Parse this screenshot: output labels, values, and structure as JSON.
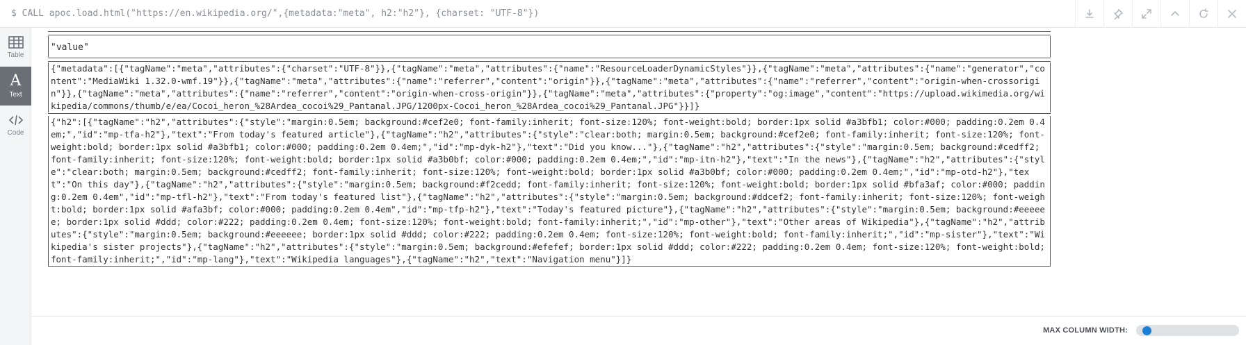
{
  "command": {
    "text": "$ CALL apoc.load.html(\"https://en.wikipedia.org/\",{metadata:\"meta\", h2:\"h2\"}, {charset: \"UTF-8\"})"
  },
  "toolbar": {
    "icons": [
      "download-icon",
      "pin-icon",
      "expand-icon",
      "collapse-up-icon",
      "rerun-icon",
      "close-icon"
    ]
  },
  "sidebar": {
    "items": [
      {
        "label": "Table",
        "icon": "table-icon"
      },
      {
        "label": "Text",
        "icon": "text-icon",
        "active": true
      },
      {
        "label": "Code",
        "icon": "code-icon"
      }
    ]
  },
  "result": {
    "header": "\"value\"",
    "rows": [
      "{\"metadata\":[{\"tagName\":\"meta\",\"attributes\":{\"charset\":\"UTF-8\"}},{\"tagName\":\"meta\",\"attributes\":{\"name\":\"ResourceLoaderDynamicStyles\"}},{\"tagName\":\"meta\",\"attributes\":{\"name\":\"generator\",\"content\":\"MediaWiki 1.32.0-wmf.19\"}},{\"tagName\":\"meta\",\"attributes\":{\"name\":\"referrer\",\"content\":\"origin\"}},{\"tagName\":\"meta\",\"attributes\":{\"name\":\"referrer\",\"content\":\"origin-when-crossorigin\"}},{\"tagName\":\"meta\",\"attributes\":{\"name\":\"referrer\",\"content\":\"origin-when-cross-origin\"}},{\"tagName\":\"meta\",\"attributes\":{\"property\":\"og:image\",\"content\":\"https://upload.wikimedia.org/wikipedia/commons/thumb/e/ea/Cocoi_heron_%28Ardea_cocoi%29_Pantanal.JPG/1200px-Cocoi_heron_%28Ardea_cocoi%29_Pantanal.JPG\"}}]}",
      "{\"h2\":[{\"tagName\":\"h2\",\"attributes\":{\"style\":\"margin:0.5em; background:#cef2e0; font-family:inherit; font-size:120%; font-weight:bold; border:1px solid #a3bfb1; color:#000; padding:0.2em 0.4em;\",\"id\":\"mp-tfa-h2\"},\"text\":\"From today's featured article\"},{\"tagName\":\"h2\",\"attributes\":{\"style\":\"clear:both; margin:0.5em; background:#cef2e0; font-family:inherit; font-size:120%; font-weight:bold; border:1px solid #a3bfb1; color:#000; padding:0.2em 0.4em;\",\"id\":\"mp-dyk-h2\"},\"text\":\"Did you know...\"},{\"tagName\":\"h2\",\"attributes\":{\"style\":\"margin:0.5em; background:#cedff2; font-family:inherit; font-size:120%; font-weight:bold; border:1px solid #a3b0bf; color:#000; padding:0.2em 0.4em;\",\"id\":\"mp-itn-h2\"},\"text\":\"In the news\"},{\"tagName\":\"h2\",\"attributes\":{\"style\":\"clear:both; margin:0.5em; background:#cedff2; font-family:inherit; font-size:120%; font-weight:bold; border:1px solid #a3b0bf; color:#000; padding:0.2em 0.4em;\",\"id\":\"mp-otd-h2\"},\"text\":\"On this day\"},{\"tagName\":\"h2\",\"attributes\":{\"style\":\"margin:0.5em; background:#f2cedd; font-family:inherit; font-size:120%; font-weight:bold; border:1px solid #bfa3af; color:#000; padding:0.2em 0.4em\",\"id\":\"mp-tfl-h2\"},\"text\":\"From today's featured list\"},{\"tagName\":\"h2\",\"attributes\":{\"style\":\"margin:0.5em; background:#ddcef2; font-family:inherit; font-size:120%; font-weight:bold; border:1px solid #afa3bf; color:#000; padding:0.2em 0.4em\",\"id\":\"mp-tfp-h2\"},\"text\":\"Today's featured picture\"},{\"tagName\":\"h2\",\"attributes\":{\"style\":\"margin:0.5em; background:#eeeeee; border:1px solid #ddd; color:#222; padding:0.2em 0.4em; font-size:120%; font-weight:bold; font-family:inherit;\",\"id\":\"mp-other\"},\"text\":\"Other areas of Wikipedia\"},{\"tagName\":\"h2\",\"attributes\":{\"style\":\"margin:0.5em; background:#eeeeee; border:1px solid #ddd; color:#222; padding:0.2em 0.4em; font-size:120%; font-weight:bold; font-family:inherit;\",\"id\":\"mp-sister\"},\"text\":\"Wikipedia's sister projects\"},{\"tagName\":\"h2\",\"attributes\":{\"style\":\"margin:0.5em; background:#efefef; border:1px solid #ddd; color:#222; padding:0.2em 0.4em; font-size:120%; font-weight:bold; font-family:inherit;\",\"id\":\"mp-lang\"},\"text\":\"Wikipedia languages\"},{\"tagName\":\"h2\",\"text\":\"Navigation menu\"}]}"
    ]
  },
  "footer": {
    "max_column_width_label": "MAX COLUMN WIDTH:",
    "max_column_width_level": 0.05
  }
}
